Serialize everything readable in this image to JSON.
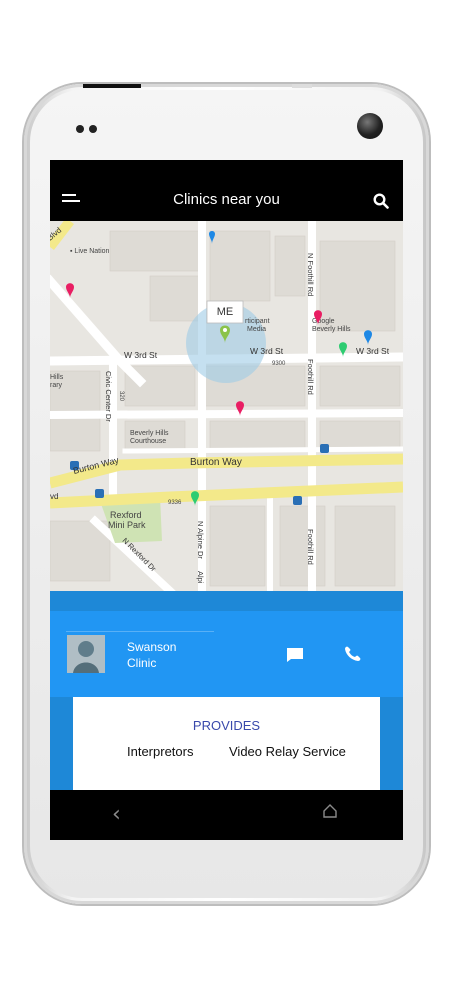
{
  "app": {
    "title": "Clinics near you"
  },
  "map": {
    "me_label": "ME",
    "streets": [
      "W 3rd St",
      "W 3rd St",
      "Burton Way",
      "Burton Way",
      "Civic Center Dr",
      "N Foothill Rd",
      "Foothill Rd",
      "N Alpine Dr",
      "Alpi",
      "N Rexford Dr",
      "Blvd",
      "Blvd"
    ],
    "places": [
      "Live Nation",
      "Participant Media",
      "Google Beverly Hills",
      "Beverly Hills Courthouse",
      "Rexford Mini Park",
      "Hills",
      "rary"
    ],
    "numbers": [
      "9300",
      "320",
      "9336"
    ]
  },
  "clinic": {
    "name_line1": "Swanson",
    "name_line2": "Clinic"
  },
  "provides": {
    "title": "PROVIDES",
    "services": [
      "Interpretors",
      "Video Relay Service"
    ]
  },
  "colors": {
    "accent": "#2196f3",
    "accent_dark": "#1e88d7",
    "provides_title": "#3949ab",
    "road_major": "#f3e98a"
  },
  "icons": {
    "menu": "menu-icon",
    "search": "search-icon",
    "message": "message-icon",
    "call": "phone-icon",
    "back": "back-icon",
    "home": "home-icon"
  }
}
